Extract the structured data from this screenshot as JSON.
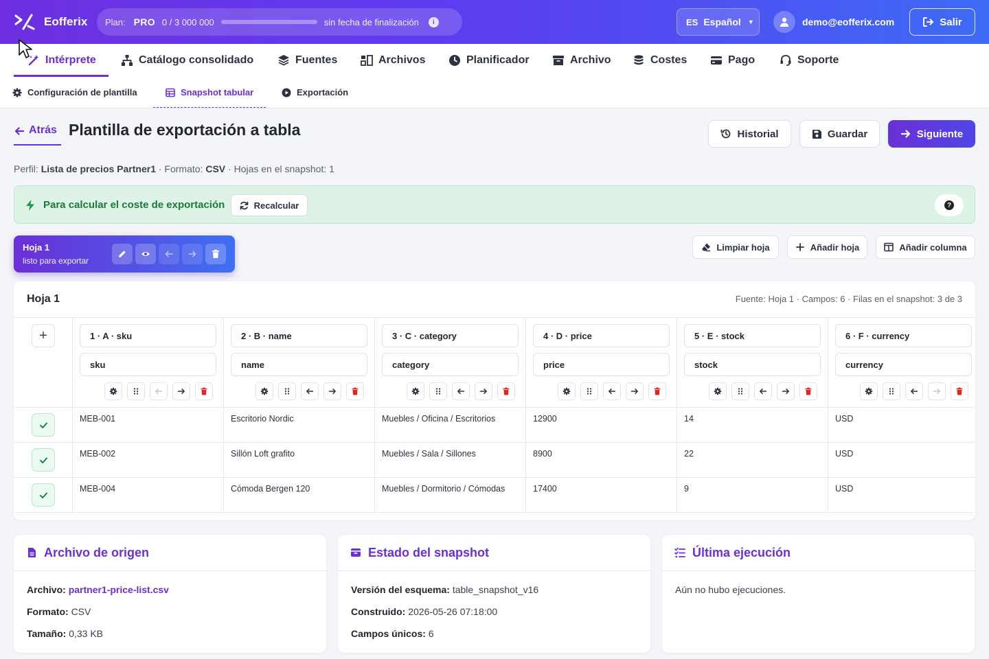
{
  "app": {
    "name": "Eofferix"
  },
  "plan": {
    "label": "Plan:",
    "name": "PRO",
    "usage": "0 / 3 000 000",
    "usage_fraction": 0,
    "expiry": "sin fecha de finalización"
  },
  "language": {
    "code": "ES",
    "name": "Español"
  },
  "user": {
    "email": "demo@eofferix.com"
  },
  "logout_label": "Salir",
  "nav": {
    "items": [
      {
        "label": "Intérprete",
        "icon": "magic-wand-icon",
        "active": true
      },
      {
        "label": "Catálogo consolidado",
        "icon": "sitemap-icon"
      },
      {
        "label": "Fuentes",
        "icon": "layers-icon"
      },
      {
        "label": "Archivos",
        "icon": "files-icon"
      },
      {
        "label": "Planificador",
        "icon": "clock-icon"
      },
      {
        "label": "Archivo",
        "icon": "archive-icon"
      },
      {
        "label": "Costes",
        "icon": "coins-icon"
      },
      {
        "label": "Pago",
        "icon": "credit-card-icon"
      },
      {
        "label": "Soporte",
        "icon": "headset-icon"
      }
    ]
  },
  "subnav": {
    "items": [
      {
        "label": "Configuración de plantilla",
        "icon": "gear-icon"
      },
      {
        "label": "Snapshot tabular",
        "icon": "table-icon",
        "active": true
      },
      {
        "label": "Exportación",
        "icon": "play-circle-icon"
      }
    ]
  },
  "page": {
    "back_label": "Atrás",
    "title": "Plantilla de exportación a tabla",
    "buttons": {
      "history": "Historial",
      "save": "Guardar",
      "next": "Siguiente"
    },
    "meta": {
      "profile_label": "Perfil:",
      "profile_value": "Lista de precios Partner1",
      "format_label": "· Formato:",
      "format_value": "CSV",
      "sheets_text": "· Hojas en el snapshot: 1"
    }
  },
  "cost_banner": {
    "text": "Para calcular el coste de exportación",
    "recalc_label": "Recalcular"
  },
  "sheet_tab": {
    "name": "Hoja 1",
    "status": "listo para exportar"
  },
  "sheet_tools": {
    "clear": "Limpiar hoja",
    "add_sheet": "Añadir hoja",
    "add_column": "Añadir columna"
  },
  "table": {
    "title": "Hoja 1",
    "meta": "Fuente: Hoja 1 · Campos: 6 · Filas en el snapshot: 3 de 3",
    "add_column_symbol": "+",
    "columns": [
      {
        "header": "1 · A · sku",
        "field": "sku"
      },
      {
        "header": "2 · B · name",
        "field": "name"
      },
      {
        "header": "3 · C · category",
        "field": "category"
      },
      {
        "header": "4 · D · price",
        "field": "price"
      },
      {
        "header": "5 · E · stock",
        "field": "stock"
      },
      {
        "header": "6 · F · currency",
        "field": "currency"
      }
    ],
    "rows": [
      [
        "MEB-001",
        "Escritorio Nordic",
        "Muebles / Oficina / Escritorios",
        "12900",
        "14",
        "USD"
      ],
      [
        "MEB-002",
        "Sillón Loft grafito",
        "Muebles / Sala / Sillones",
        "8900",
        "22",
        "USD"
      ],
      [
        "MEB-004",
        "Cómoda Bergen 120",
        "Muebles / Dormitorio / Cómodas",
        "17400",
        "9",
        "USD"
      ]
    ]
  },
  "cards": {
    "source": {
      "title": "Archivo de origen",
      "file_label": "Archivo:",
      "file_value": "partner1-price-list.csv",
      "format_label": "Formato:",
      "format_value": "CSV",
      "size_label": "Tamaño:",
      "size_value": "0,33 KB"
    },
    "snapshot": {
      "title": "Estado del snapshot",
      "schema_label": "Versión del esquema:",
      "schema_value": "table_snapshot_v16",
      "built_label": "Construido:",
      "built_value": "2026-05-26 07:18:00",
      "fields_label": "Campos únicos:",
      "fields_value": "6"
    },
    "last_run": {
      "title": "Última ejecución",
      "text": "Aún no hubo ejecuciones."
    }
  },
  "colors": {
    "accent": "#6a2fd6",
    "gradient_end": "#3d6bf5",
    "success": "#1b7a3c",
    "danger": "#e02424"
  }
}
